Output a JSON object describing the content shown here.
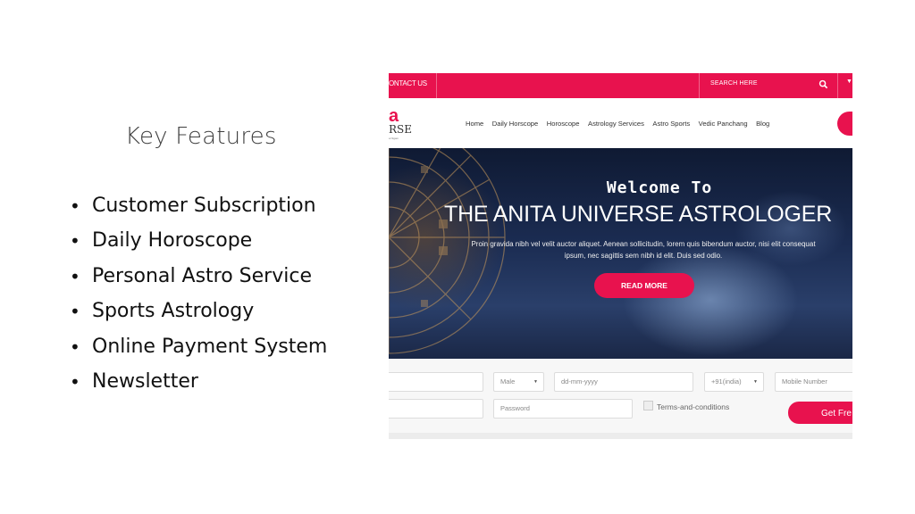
{
  "slide": {
    "title": "Key Features",
    "bullets": [
      "Customer Subscription",
      "Daily Horoscope",
      "Personal Astro Service",
      "Sports Astrology",
      "Online Payment System",
      "Newsletter"
    ]
  },
  "site": {
    "topbar": {
      "contact": "ONTACT US",
      "search_placeholder": "SEARCH HERE"
    },
    "logo": {
      "mark": "a",
      "name": "RSE",
      "tagline": "a Nigam"
    },
    "nav": [
      "Home",
      "Daily Horscope",
      "Horoscope",
      "Astrology Services",
      "Astro Sports",
      "Vedic Panchang",
      "Blog"
    ],
    "hero": {
      "welcome": "Welcome To",
      "headline": "THE ANITA UNIVERSE ASTROLOGER",
      "description": "Proin gravida nibh vel velit auctor aliquet. Aenean sollicitudin, lorem quis bibendum auctor, nisi elit consequat ipsum, nec sagittis sem nibh id elit. Duis sed odio.",
      "button": "READ MORE"
    },
    "form": {
      "gender": "Male",
      "dob_placeholder": "dd-mm-yyyy",
      "country_code": "+91(india)",
      "mobile_placeholder": "Mobile Number",
      "password_placeholder": "Password",
      "terms": "Terms-and-conditions",
      "submit": "Get Fre"
    },
    "colors": {
      "accent": "#e8124e",
      "hero_dark": "#0f1a33"
    }
  }
}
